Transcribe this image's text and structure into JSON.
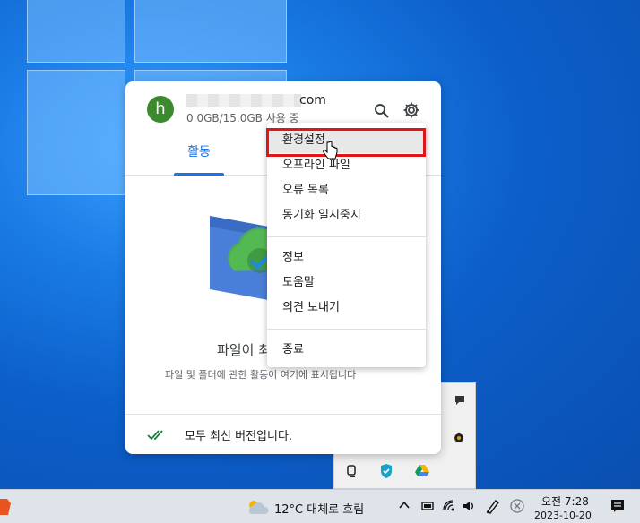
{
  "popup": {
    "avatar_letter": "h",
    "email_suffix": "com",
    "storage": "0.0GB/15.0GB 사용 중",
    "tab_activity": "활동",
    "empty_title": "파일이 최",
    "empty_desc": "파일 및 폴더에 관한 활동이 여기에 표시됩니다",
    "footer_status": "모두 최신 버전입니다."
  },
  "menu": {
    "items": [
      {
        "label": "환경설정",
        "highlighted": true
      },
      {
        "label": "오프라인 파일"
      },
      {
        "label": "오류 목록"
      },
      {
        "label": "동기화 일시중지"
      },
      {
        "label": "정보"
      },
      {
        "label": "도움말"
      },
      {
        "label": "의견 보내기"
      },
      {
        "label": "종료"
      }
    ]
  },
  "taskbar": {
    "weather": "12°C  대체로 흐림",
    "time": "오전 7:28",
    "date": "2023-10-20"
  },
  "colors": {
    "accent": "#1a73e8",
    "highlight_border": "#e01515",
    "avatar": "#3c8a2e"
  },
  "icons": [
    "search-icon",
    "gear-icon",
    "check-double-icon",
    "weather-cloud-icon",
    "chevron-up-icon",
    "battery-icon",
    "wifi-icon",
    "speaker-icon",
    "pen-icon",
    "close-circle-icon",
    "notification-icon",
    "mouse-pointer-icon"
  ]
}
